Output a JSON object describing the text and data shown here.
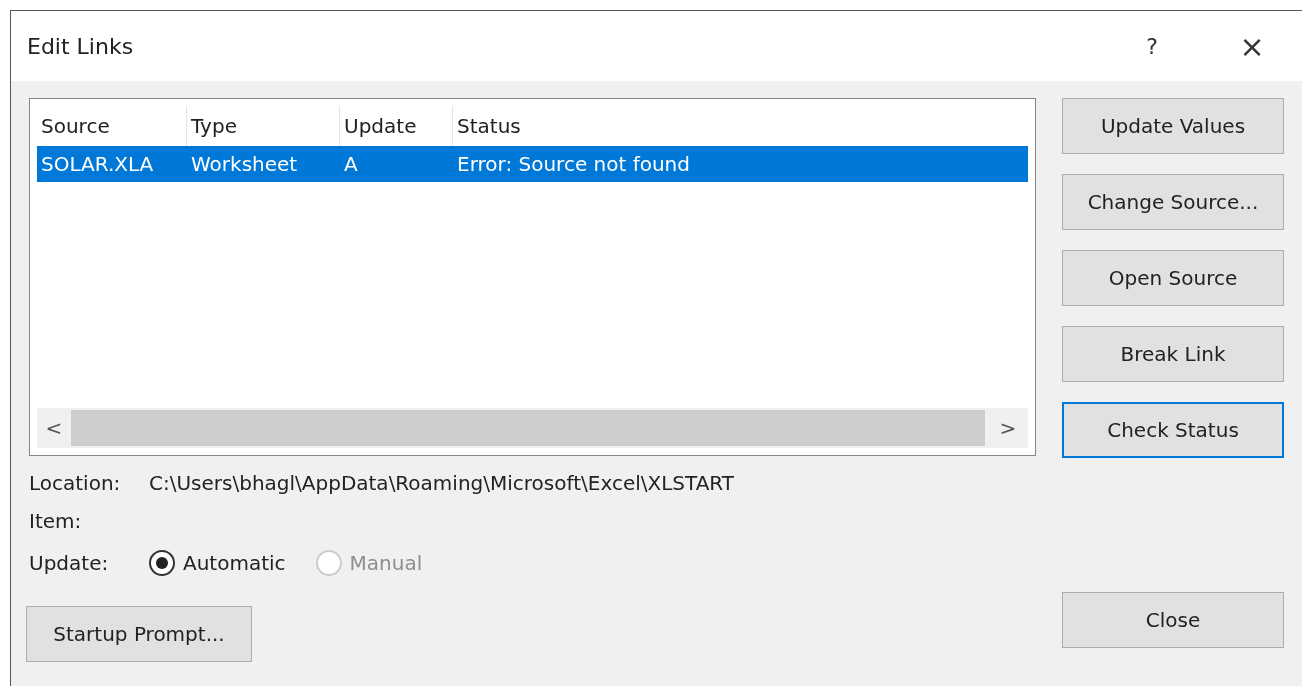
{
  "window": {
    "title": "Edit Links",
    "help": "?",
    "close": "×"
  },
  "links_table": {
    "columns": [
      "Source",
      "Type",
      "Update",
      "Status"
    ],
    "rows": [
      {
        "cells": [
          "SOLAR.XLA",
          "Worksheet",
          "A",
          "Error: Source not found"
        ],
        "selected": true
      }
    ],
    "scroll_left": "<",
    "scroll_right": ">"
  },
  "side_buttons": [
    {
      "label": "Update Values",
      "focused": false
    },
    {
      "label": "Change Source...",
      "focused": false
    },
    {
      "label": "Open Source",
      "focused": false
    },
    {
      "label": "Break Link",
      "focused": false
    },
    {
      "label": "Check Status",
      "focused": true
    }
  ],
  "details": [
    {
      "label": "Location:",
      "value": "C:\\Users\\bhagl\\AppData\\Roaming\\Microsoft\\Excel\\XLSTART"
    },
    {
      "label": "Item:"
    }
  ],
  "update": {
    "label": "Update:",
    "options": [
      {
        "label": "Automatic",
        "selected": true,
        "disabled": false
      },
      {
        "label": "Manual",
        "selected": false,
        "disabled": true
      }
    ]
  },
  "startup_button": "Startup Prompt...",
  "close_button": "Close"
}
